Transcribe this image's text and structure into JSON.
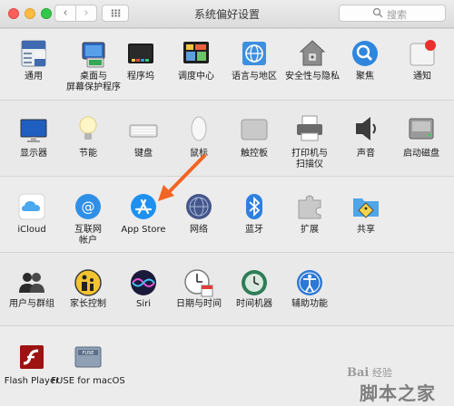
{
  "window": {
    "title": "系统偏好设置"
  },
  "search": {
    "placeholder": "搜索"
  },
  "rows": [
    {
      "items": [
        {
          "label": "通用",
          "icon": "general-icon"
        },
        {
          "label": "桌面与\n屏幕保护程序",
          "icon": "desktop-icon"
        },
        {
          "label": "程序坞",
          "icon": "dock-icon"
        },
        {
          "label": "调度中心",
          "icon": "mission-control-icon"
        },
        {
          "label": "语言与地区",
          "icon": "language-region-icon"
        },
        {
          "label": "安全性与隐私",
          "icon": "security-icon"
        },
        {
          "label": "聚焦",
          "icon": "spotlight-icon"
        },
        {
          "label": "通知",
          "icon": "notifications-icon"
        }
      ]
    },
    {
      "items": [
        {
          "label": "显示器",
          "icon": "displays-icon"
        },
        {
          "label": "节能",
          "icon": "energy-saver-icon"
        },
        {
          "label": "键盘",
          "icon": "keyboard-icon"
        },
        {
          "label": "鼠标",
          "icon": "mouse-icon"
        },
        {
          "label": "触控板",
          "icon": "trackpad-icon"
        },
        {
          "label": "打印机与\n扫描仪",
          "icon": "printer-icon"
        },
        {
          "label": "声音",
          "icon": "sound-icon"
        },
        {
          "label": "启动磁盘",
          "icon": "startup-disk-icon"
        }
      ]
    },
    {
      "items": [
        {
          "label": "iCloud",
          "icon": "icloud-icon"
        },
        {
          "label": "互联网\n帐户",
          "icon": "internet-accounts-icon"
        },
        {
          "label": "App Store",
          "icon": "app-store-icon"
        },
        {
          "label": "网络",
          "icon": "network-icon"
        },
        {
          "label": "蓝牙",
          "icon": "bluetooth-icon"
        },
        {
          "label": "扩展",
          "icon": "extensions-icon"
        },
        {
          "label": "共享",
          "icon": "sharing-icon"
        }
      ]
    },
    {
      "items": [
        {
          "label": "用户与群组",
          "icon": "users-groups-icon"
        },
        {
          "label": "家长控制",
          "icon": "parental-controls-icon"
        },
        {
          "label": "Siri",
          "icon": "siri-icon"
        },
        {
          "label": "日期与时间",
          "icon": "date-time-icon"
        },
        {
          "label": "时间机器",
          "icon": "time-machine-icon"
        },
        {
          "label": "辅助功能",
          "icon": "accessibility-icon"
        }
      ]
    },
    {
      "items": [
        {
          "label": "Flash Player",
          "icon": "flash-player-icon"
        },
        {
          "label": "FUSE for macOS",
          "icon": "fuse-icon"
        }
      ]
    }
  ],
  "watermark": {
    "line1": "Bai",
    "line2": "脚本之家",
    "line3": "经验"
  },
  "colors": {
    "annotation_arrow": "#f26522",
    "window_bg": "#ececec"
  }
}
